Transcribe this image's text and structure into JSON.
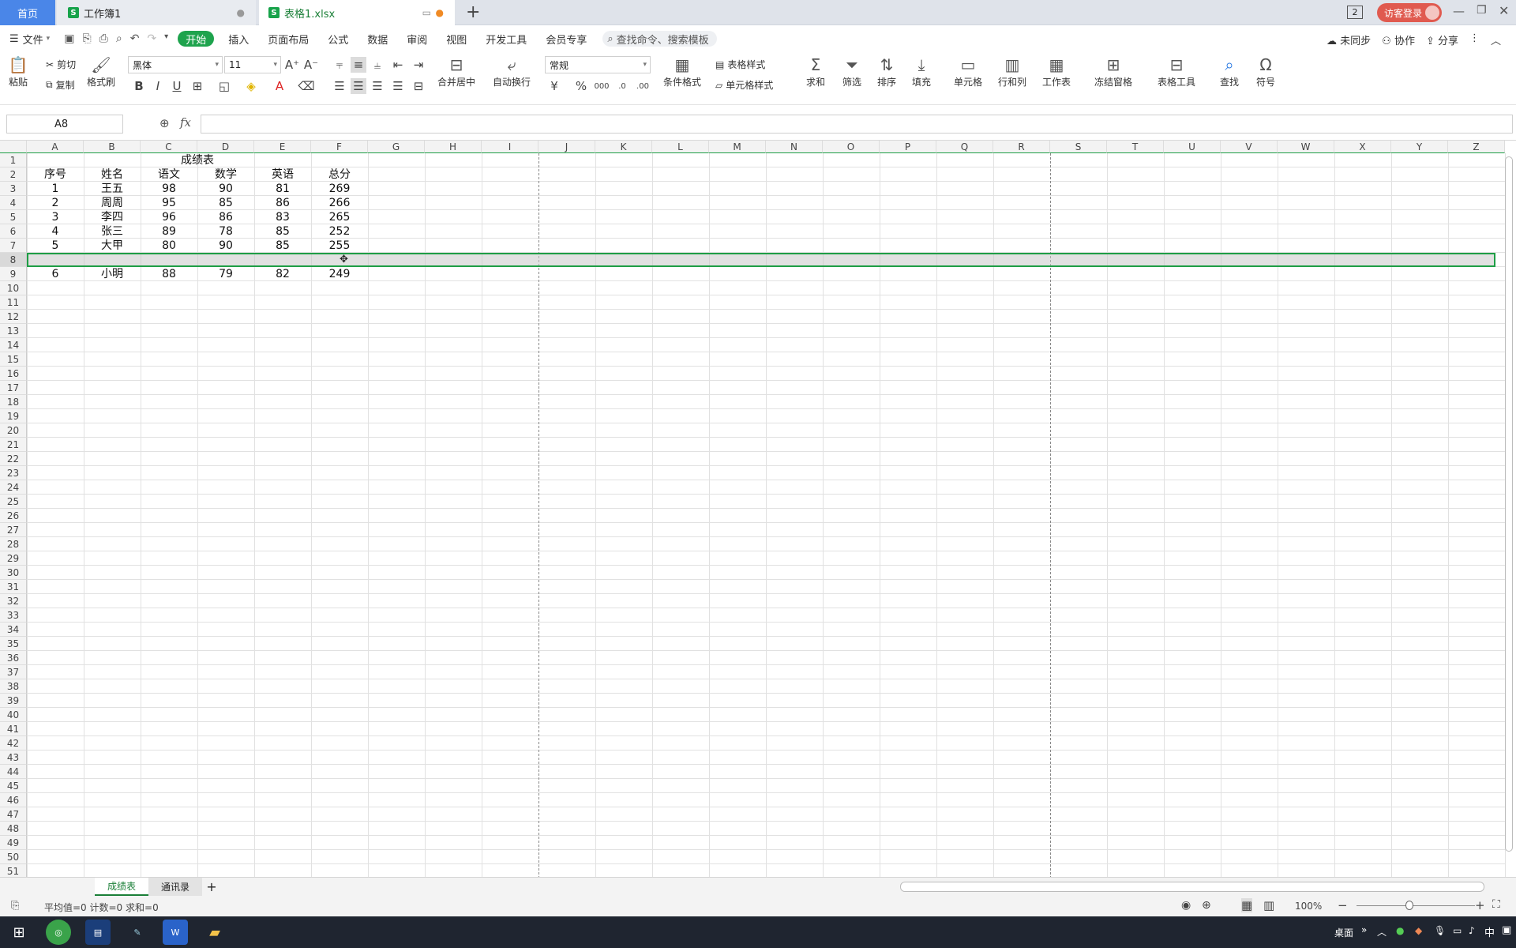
{
  "tabs": {
    "home": "首页",
    "workbook": "工作簿1",
    "file": "表格1.xlsx"
  },
  "titlebar": {
    "badge": "2",
    "login": "访客登录"
  },
  "menu": {
    "file": "文件",
    "items": [
      "开始",
      "插入",
      "页面布局",
      "公式",
      "数据",
      "审阅",
      "视图",
      "开发工具",
      "会员专享"
    ],
    "search": "查找命令、搜索模板",
    "sync": "未同步",
    "collab": "协作",
    "share": "分享"
  },
  "ribbon": {
    "paste": "粘贴",
    "cut": "剪切",
    "copy": "复制",
    "format_painter": "格式刷",
    "font": "黑体",
    "size": "11",
    "merge": "合并居中",
    "wrap": "自动换行",
    "numfmt": "常规",
    "cond": "条件格式",
    "table_style": "表格样式",
    "cell_style": "单元格样式",
    "sum": "求和",
    "filter": "筛选",
    "sort": "排序",
    "fill": "填充",
    "cells": "单元格",
    "rowcol": "行和列",
    "sheet": "工作表",
    "freeze": "冻结窗格",
    "tools": "表格工具",
    "find": "查找",
    "symbol": "符号"
  },
  "formula": {
    "cell_ref": "A8",
    "fx": "fx",
    "value": ""
  },
  "columns": [
    "A",
    "B",
    "C",
    "D",
    "E",
    "F",
    "G",
    "H",
    "I",
    "J",
    "K",
    "L",
    "M",
    "N",
    "O",
    "P",
    "Q",
    "R",
    "S",
    "T",
    "U",
    "V",
    "W",
    "X",
    "Y",
    "Z"
  ],
  "sheet": {
    "title": "成绩表",
    "headers": [
      "序号",
      "姓名",
      "语文",
      "数学",
      "英语",
      "总分"
    ],
    "rows": [
      [
        "1",
        "王五",
        "98",
        "90",
        "81",
        "269"
      ],
      [
        "2",
        "周周",
        "95",
        "85",
        "86",
        "266"
      ],
      [
        "3",
        "李四",
        "96",
        "86",
        "83",
        "265"
      ],
      [
        "4",
        "张三",
        "89",
        "78",
        "85",
        "252"
      ],
      [
        "5",
        "大甲",
        "80",
        "90",
        "85",
        "255"
      ],
      [
        "",
        "",
        "",
        "",
        "",
        ""
      ],
      [
        "6",
        "小明",
        "88",
        "79",
        "82",
        "249"
      ]
    ]
  },
  "sheet_tabs": [
    "成绩表",
    "通讯录"
  ],
  "status": {
    "text": "平均值=0  计数=0  求和=0",
    "zoom": "100%"
  },
  "taskbar": {
    "desktop": "桌面",
    "ime": "中"
  }
}
